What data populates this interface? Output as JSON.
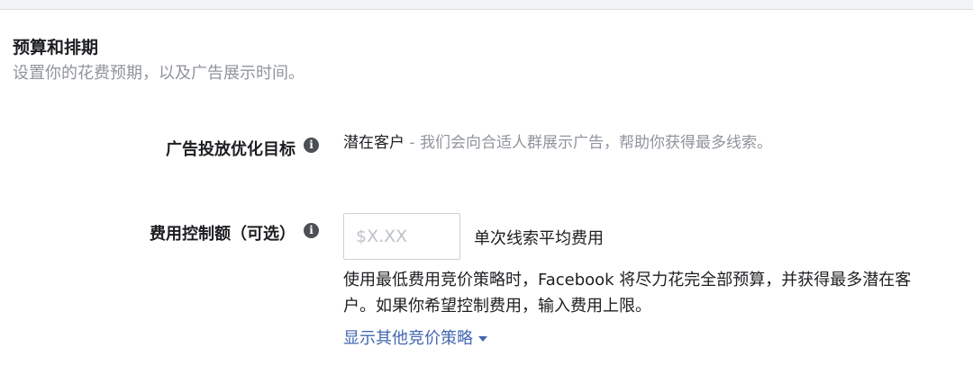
{
  "section": {
    "title": "预算和排期",
    "subtitle": "设置你的花费预期，以及广告展示时间。"
  },
  "optimization_goal": {
    "label": "广告投放优化目标",
    "info_icon": "info-icon",
    "value": "潜在客户",
    "description": " - 我们会向合适人群展示广告，帮助你获得最多线索。"
  },
  "cost_control": {
    "label": "费用控制额（可选）",
    "info_icon": "info-icon",
    "input_placeholder": "$X.XX",
    "input_value": "",
    "input_suffix": "单次线索平均费用",
    "help_text": "使用最低费用竞价策略时，Facebook 将尽力花完全部预算，并获得最多潜在客户。如果你希望控制费用，输入费用上限。",
    "strategy_link": "显示其他竞价策略",
    "strategy_link_icon": "caret-down-icon"
  },
  "colors": {
    "text_primary": "#1c1e21",
    "text_secondary": "#90949c",
    "link": "#4267b2",
    "border": "#ccd0d5",
    "icon": "#4b4f56"
  }
}
